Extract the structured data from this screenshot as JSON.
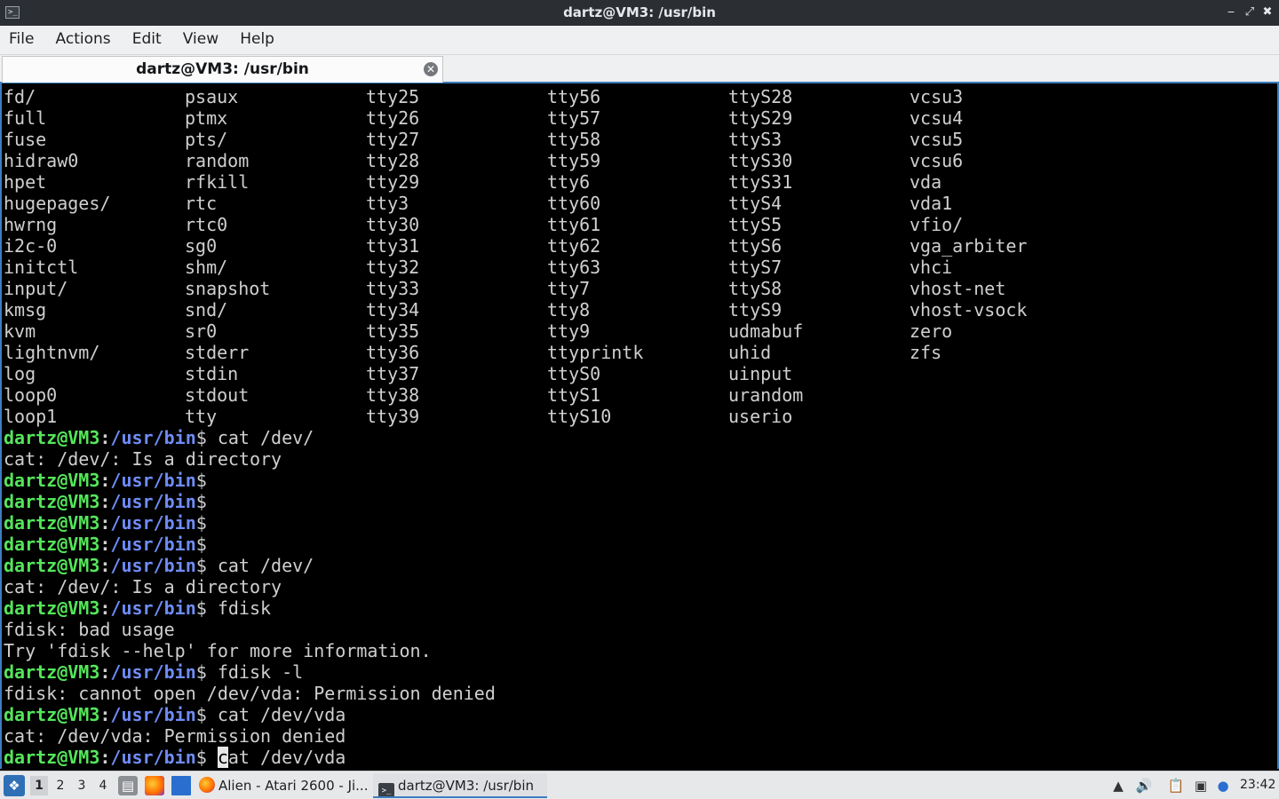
{
  "window": {
    "title": "dartz@VM3: /usr/bin",
    "controls": {
      "minimize": "minimize-icon",
      "maximize": "maximize-icon",
      "close": "close-icon"
    }
  },
  "menu": [
    "File",
    "Actions",
    "Edit",
    "View",
    "Help"
  ],
  "tab": {
    "label": "dartz@VM3: /usr/bin"
  },
  "listing": [
    [
      "fd/",
      "psaux",
      "tty25",
      "tty56",
      "ttyS28",
      "vcsu3"
    ],
    [
      "full",
      "ptmx",
      "tty26",
      "tty57",
      "ttyS29",
      "vcsu4"
    ],
    [
      "fuse",
      "pts/",
      "tty27",
      "tty58",
      "ttyS3",
      "vcsu5"
    ],
    [
      "hidraw0",
      "random",
      "tty28",
      "tty59",
      "ttyS30",
      "vcsu6"
    ],
    [
      "hpet",
      "rfkill",
      "tty29",
      "tty6",
      "ttyS31",
      "vda"
    ],
    [
      "hugepages/",
      "rtc",
      "tty3",
      "tty60",
      "ttyS4",
      "vda1"
    ],
    [
      "hwrng",
      "rtc0",
      "tty30",
      "tty61",
      "ttyS5",
      "vfio/"
    ],
    [
      "i2c-0",
      "sg0",
      "tty31",
      "tty62",
      "ttyS6",
      "vga_arbiter"
    ],
    [
      "initctl",
      "shm/",
      "tty32",
      "tty63",
      "ttyS7",
      "vhci"
    ],
    [
      "input/",
      "snapshot",
      "tty33",
      "tty7",
      "ttyS8",
      "vhost-net"
    ],
    [
      "kmsg",
      "snd/",
      "tty34",
      "tty8",
      "ttyS9",
      "vhost-vsock"
    ],
    [
      "kvm",
      "sr0",
      "tty35",
      "tty9",
      "udmabuf",
      "zero"
    ],
    [
      "lightnvm/",
      "stderr",
      "tty36",
      "ttyprintk",
      "uhid",
      "zfs"
    ],
    [
      "log",
      "stdin",
      "tty37",
      "ttyS0",
      "uinput",
      ""
    ],
    [
      "loop0",
      "stdout",
      "tty38",
      "ttyS1",
      "urandom",
      ""
    ],
    [
      "loop1",
      "tty",
      "tty39",
      "ttyS10",
      "userio",
      ""
    ]
  ],
  "prompt": {
    "user": "dartz@VM3",
    "colon": ":",
    "path": "/usr/bin",
    "dollar": "$"
  },
  "session": [
    {
      "kind": "prompt",
      "cmd": " cat /dev/"
    },
    {
      "kind": "out",
      "text": "cat: /dev/: Is a directory"
    },
    {
      "kind": "prompt",
      "cmd": ""
    },
    {
      "kind": "prompt",
      "cmd": ""
    },
    {
      "kind": "prompt",
      "cmd": ""
    },
    {
      "kind": "prompt",
      "cmd": ""
    },
    {
      "kind": "prompt",
      "cmd": " cat /dev/"
    },
    {
      "kind": "out",
      "text": "cat: /dev/: Is a directory"
    },
    {
      "kind": "prompt",
      "cmd": " fdisk"
    },
    {
      "kind": "out",
      "text": "fdisk: bad usage"
    },
    {
      "kind": "out",
      "text": "Try 'fdisk --help' for more information."
    },
    {
      "kind": "prompt",
      "cmd": " fdisk -l"
    },
    {
      "kind": "out",
      "text": "fdisk: cannot open /dev/vda: Permission denied"
    },
    {
      "kind": "prompt",
      "cmd": " cat /dev/vda"
    },
    {
      "kind": "out",
      "text": "cat: /dev/vda: Permission denied"
    },
    {
      "kind": "current",
      "cmd": " cat /dev/vda"
    }
  ],
  "taskbar": {
    "start_icon": "start-menu-icon",
    "desktops": [
      "1",
      "2",
      "3",
      "4"
    ],
    "active_desktop": "1",
    "launchers": [
      "file-manager-icon",
      "firefox-icon",
      "desktop-icon"
    ],
    "tasks": [
      {
        "label": "Alien - Atari 2600 - Ji...",
        "icon": "firefox-icon",
        "active": false
      },
      {
        "label": "dartz@VM3: /usr/bin",
        "icon": "terminal-icon",
        "active": true
      }
    ],
    "tray": [
      "upload-icon",
      "volume-icon",
      "clipboard-icon",
      "network-icon",
      "notification-icon"
    ],
    "clock": "23:42"
  },
  "colors": {
    "prompt_user": "#54e65a",
    "prompt_path": "#6f8cf6",
    "terminal_text": "#cfcfcf",
    "terminal_bg": "#000000",
    "accent": "#3d7ebf",
    "titlebar_bg": "#2b2e33"
  }
}
